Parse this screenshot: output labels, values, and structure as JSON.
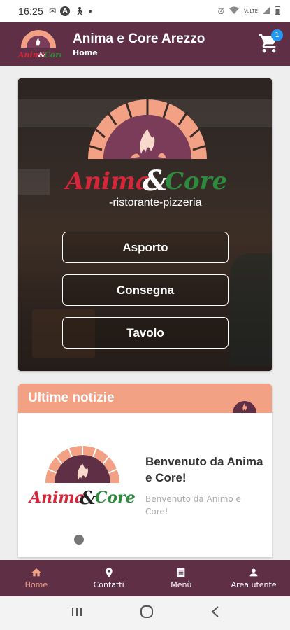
{
  "status_bar": {
    "time": "16:25",
    "wifi_label": "VoLTE"
  },
  "app_bar": {
    "title": "Anima e Core Arezzo",
    "breadcrumb": "Home",
    "cart_count": "1"
  },
  "hero": {
    "logo_text_1": "Anima",
    "logo_amp": "&",
    "logo_text_2": "Core",
    "logo_subtitle": "-ristorante-pizzeria",
    "buttons": [
      "Asporto",
      "Consegna",
      "Tavolo"
    ]
  },
  "news": {
    "header": "Ultime notizie",
    "item": {
      "logo_text_1": "Anima",
      "logo_amp": "&",
      "logo_text_2": "Core",
      "title": "Benvenuto da Anima e Core!",
      "description": "Benvenuto da Animo e Core!"
    }
  },
  "bottom_nav": {
    "tabs": [
      {
        "label": "Home",
        "icon": "home-icon",
        "active": true
      },
      {
        "label": "Contatti",
        "icon": "location-pin-icon",
        "active": false
      },
      {
        "label": "Menù",
        "icon": "menu-book-icon",
        "active": false
      },
      {
        "label": "Area utente",
        "icon": "user-icon",
        "active": false
      }
    ]
  },
  "colors": {
    "primary": "#5e2f45",
    "accent": "#f3a184",
    "badge": "#2196f3",
    "logo_red": "#d6263a",
    "logo_green": "#2e8b3d"
  }
}
